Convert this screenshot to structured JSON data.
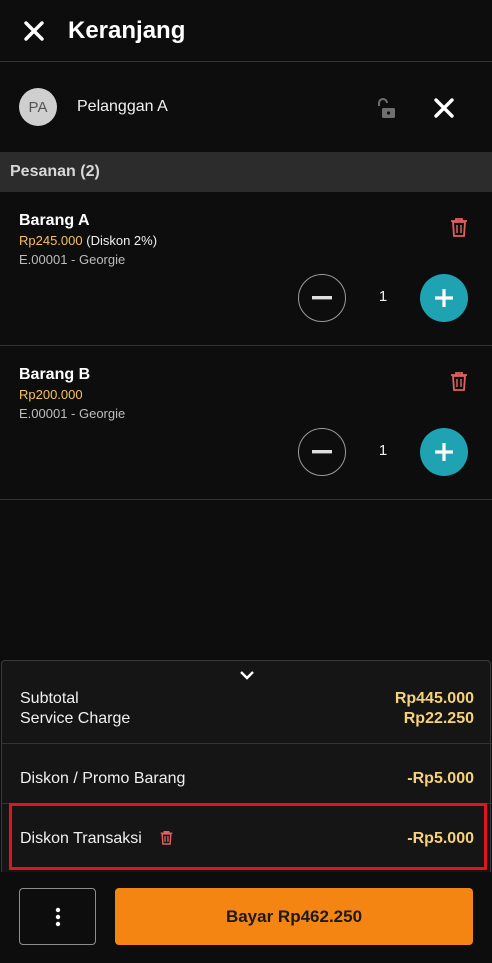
{
  "header": {
    "title": "Keranjang"
  },
  "customer": {
    "initials": "PA",
    "name": "Pelanggan A"
  },
  "orders": {
    "section_label": "Pesanan (2)",
    "items": [
      {
        "name": "Barang A",
        "price": "Rp245.000",
        "discount": "(Diskon 2%)",
        "staff": "E.00001 - Georgie",
        "qty": "1"
      },
      {
        "name": "Barang B",
        "price": "Rp200.000",
        "discount": "",
        "staff": "E.00001 - Georgie",
        "qty": "1"
      }
    ]
  },
  "summary": {
    "subtotal_label": "Subtotal",
    "subtotal_value": "Rp445.000",
    "service_label": "Service Charge",
    "service_value": "Rp22.250",
    "item_discount_label": "Diskon / Promo Barang",
    "item_discount_value": "-Rp5.000",
    "trx_discount_label": "Diskon Transaksi",
    "trx_discount_value": "-Rp5.000"
  },
  "footer": {
    "pay_label": "Bayar Rp462.250"
  },
  "colors": {
    "accent": "#f58512",
    "teal": "#1fa2b2",
    "price": "#f6c25d",
    "delete": "#e06060",
    "highlight": "#e0161e"
  },
  "icons": {
    "close": "close-icon",
    "lock": "unlock-icon",
    "trash": "trash-icon",
    "minus": "minus-icon",
    "plus": "plus-icon",
    "chevron": "chevron-down-icon",
    "more": "more-vertical-icon"
  }
}
